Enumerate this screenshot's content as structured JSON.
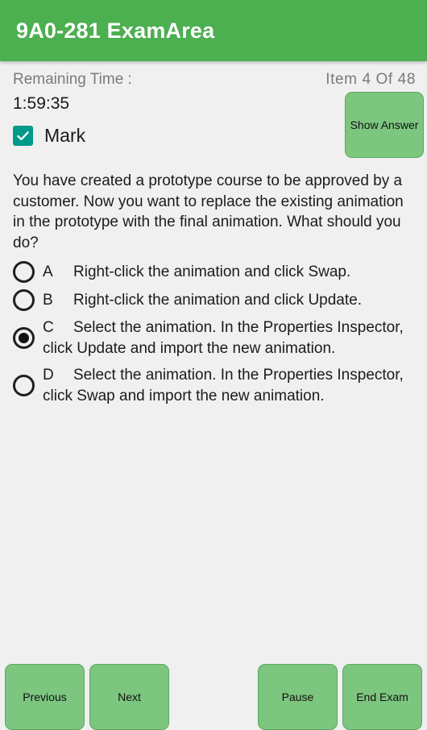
{
  "app": {
    "title": "9A0-281 ExamArea",
    "brand_green": "#4caf50",
    "button_green": "#7dc67f",
    "checkbox_teal": "#00998a",
    "background": "#f0f0f0"
  },
  "status": {
    "remaining_time_label": "Remaining Time :",
    "item_counter": "Item  4  Of  48"
  },
  "meta": {
    "timer_value": "1:59:35",
    "mark_label": "Mark",
    "mark_checked": true,
    "mark_icon": "check-icon",
    "show_answer_label": "Show Answer"
  },
  "question": {
    "text": "You have created a prototype course to be approved by a customer. Now you want to replace the existing animation in the prototype with the final animation. What should you do?",
    "options": [
      {
        "letter": "A",
        "text": "Right-click the animation and click Swap.",
        "selected": false
      },
      {
        "letter": "B",
        "text": "Right-click the animation and click Update.",
        "selected": false
      },
      {
        "letter": "C",
        "text": "Select the animation. In the Properties Inspector, click Update and import the new animation.",
        "selected": true
      },
      {
        "letter": "D",
        "text": "Select the animation. In the Properties Inspector, click Swap and import the new animation.",
        "selected": false
      }
    ]
  },
  "bottom_bar": {
    "previous_label": "Previous",
    "next_label": "Next",
    "pause_label": "Pause",
    "end_exam_label": "End Exam"
  }
}
